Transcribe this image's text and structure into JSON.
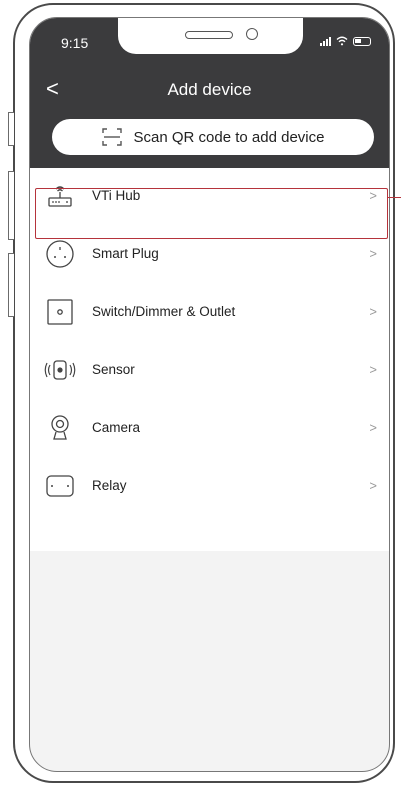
{
  "status_bar": {
    "time": "9:15"
  },
  "header": {
    "back_glyph": "<",
    "title": "Add device"
  },
  "scan_button": {
    "label": "Scan QR code to add device",
    "icon": "scan-qr-icon"
  },
  "devices": [
    {
      "label": "VTi Hub",
      "icon": "hub-icon",
      "chevron": ">"
    },
    {
      "label": "Smart Plug",
      "icon": "plug-icon",
      "chevron": ">"
    },
    {
      "label": "Switch/Dimmer & Outlet",
      "icon": "switch-icon",
      "chevron": ">"
    },
    {
      "label": "Sensor",
      "icon": "sensor-icon",
      "chevron": ">"
    },
    {
      "label": "Camera",
      "icon": "camera-icon",
      "chevron": ">"
    },
    {
      "label": "Relay",
      "icon": "relay-icon",
      "chevron": ">"
    }
  ],
  "colors": {
    "header_bg": "#3b3b3d",
    "highlight": "#b5333b"
  }
}
